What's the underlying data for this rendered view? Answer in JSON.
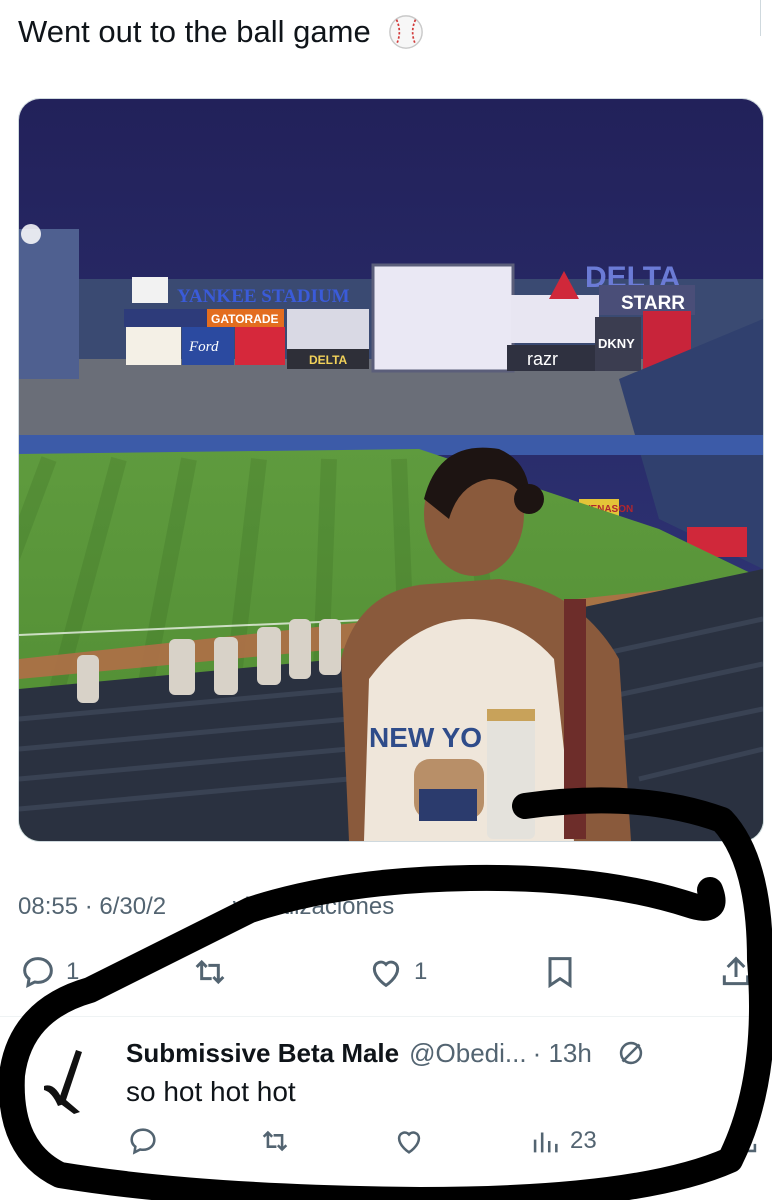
{
  "tweet": {
    "text": "Went out to the ball game",
    "timestamp": "08:55 · 6/30/2",
    "views_label": "visualizaciones",
    "reply_count": "1",
    "like_count": "1"
  },
  "photo": {
    "signs": {
      "yankee_stadium": "YANKEE STADIUM",
      "gatorade": "GATORADE",
      "delta_top": "DELTA",
      "delta_small": "DELTA",
      "starr": "STARR",
      "razr": "razr",
      "dkny": "DKNY",
      "ford": "Ford",
      "wenason": "WENASON",
      "shirt_text": "NEW YO"
    }
  },
  "reply": {
    "name": "Submissive Beta Male",
    "handle": "@Obedi...",
    "time": "· 13h",
    "text": "so hot hot hot",
    "views": "23"
  },
  "colors": {
    "text": "#0f1419",
    "secondary": "#536471",
    "border": "#cfd9de"
  }
}
